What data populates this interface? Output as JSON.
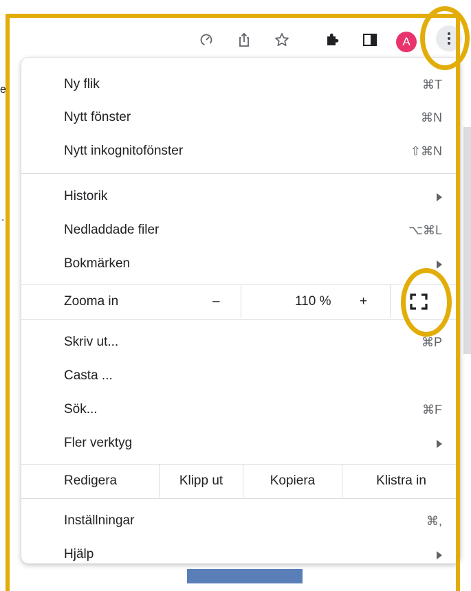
{
  "toolbar": {
    "icons": [
      "performance-icon",
      "share-icon",
      "bookmark-star-icon",
      "extensions-icon",
      "side-panel-icon"
    ],
    "avatar_letter": "A",
    "menu_button": "more-options-icon"
  },
  "background": {
    "edge_text_1": "er",
    "edge_text_2": "."
  },
  "menu": {
    "new_tab": {
      "label": "Ny flik",
      "shortcut": "⌘T"
    },
    "new_window": {
      "label": "Nytt fönster",
      "shortcut": "⌘N"
    },
    "new_incognito": {
      "label": "Nytt inkognitofönster",
      "shortcut": "⇧⌘N"
    },
    "history": {
      "label": "Historik"
    },
    "downloads": {
      "label": "Nedladdade filer",
      "shortcut": "⌥⌘L"
    },
    "bookmarks": {
      "label": "Bokmärken"
    },
    "zoom": {
      "label": "Zooma in",
      "minus": "–",
      "value": "110 %",
      "plus": "+"
    },
    "print": {
      "label": "Skriv ut...",
      "shortcut": "⌘P"
    },
    "cast": {
      "label": "Casta ..."
    },
    "find": {
      "label": "Sök...",
      "shortcut": "⌘F"
    },
    "more_tools": {
      "label": "Fler verktyg"
    },
    "edit": {
      "label": "Redigera",
      "cut": "Klipp ut",
      "copy": "Kopiera",
      "paste": "Klistra in"
    },
    "settings": {
      "label": "Inställningar",
      "shortcut": "⌘,"
    },
    "help": {
      "label": "Hjälp"
    }
  },
  "colors": {
    "highlight": "#e2ad09",
    "avatar": "#e8336d"
  }
}
